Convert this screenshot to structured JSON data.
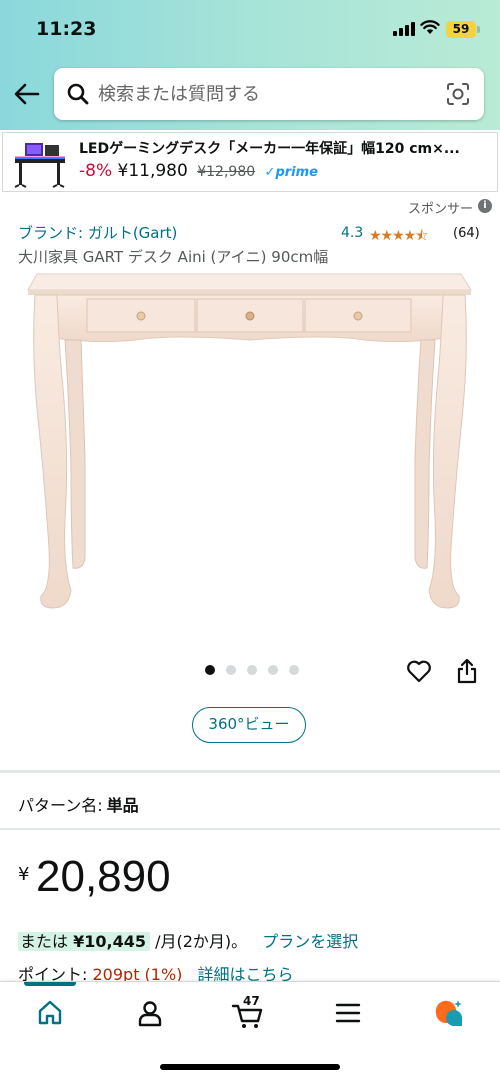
{
  "status_bar": {
    "time": "11:23",
    "battery": "59"
  },
  "header": {
    "search_placeholder": "検索または質問する"
  },
  "sponsored_ad": {
    "title": "LEDゲーミングデスク「メーカー一年保証」幅120 cm×...",
    "discount": "-8%",
    "price": "¥11,980",
    "was_price": "¥12,980",
    "prime": "✓prime"
  },
  "sponsored_label": "スポンサー",
  "product": {
    "brand": "ブランド: ガルト(Gart)",
    "rating": "4.3",
    "stars": "★★★★⯪",
    "rating_count": "(64)",
    "title": "大川家具 GART デスク Aini (アイニ) 90cm幅",
    "image_count": 5,
    "image_index": 1,
    "view360": "360°ビュー"
  },
  "pattern": {
    "label": "パターン名:",
    "value": "単品"
  },
  "price": {
    "symbol": "¥",
    "value": "20,890"
  },
  "installment": {
    "prefix": "または",
    "amount": "¥10,445",
    "suffix": "/月(2か月)。",
    "plan_link": "プランを選択"
  },
  "points": {
    "label": "ポイント:",
    "value": "209pt (1%)",
    "link": "詳細はこちら"
  },
  "bottom_nav": {
    "cart_count": "47",
    "items": [
      "home-icon",
      "account-icon",
      "cart-icon",
      "menu-icon",
      "rufus-icon"
    ]
  },
  "colors": {
    "link": "#007185",
    "price_red": "#b12704",
    "discount": "#cc0c39",
    "star": "#de7921",
    "header_start": "#8ad8dc",
    "header_end": "#b9ebd6"
  }
}
